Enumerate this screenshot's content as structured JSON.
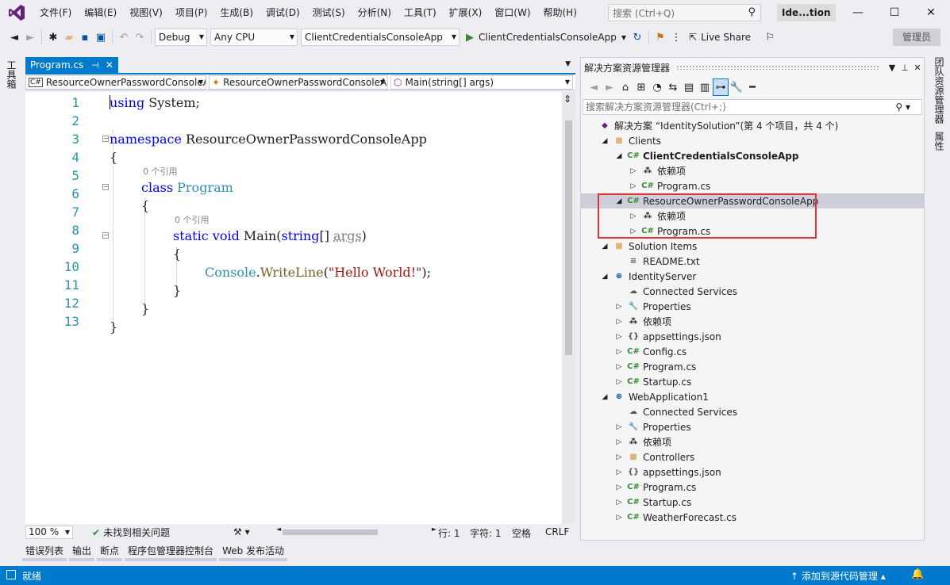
{
  "menu": {
    "items": [
      "文件(F)",
      "编辑(E)",
      "视图(V)",
      "项目(P)",
      "生成(B)",
      "调试(D)",
      "测试(S)",
      "分析(N)",
      "工具(T)",
      "扩展(X)",
      "窗口(W)",
      "帮助(H)"
    ],
    "search_placeholder": "搜索 (Ctrl+Q)",
    "title_badge": "Ide...tion"
  },
  "toolbar": {
    "config": "Debug",
    "platform": "Any CPU",
    "startup_project": "ClientCredentialsConsoleApp",
    "run_target": "ClientCredentialsConsoleApp",
    "live_share": "Live Share",
    "admin": "管理员"
  },
  "left_strip": {
    "toolbox": "工具箱"
  },
  "right_strip": {
    "team_explorer": "团队资源管理器",
    "properties": "属性"
  },
  "editor": {
    "tab_label": "Program.cs",
    "nav": {
      "project": "ResourceOwnerPasswordConsoleApp",
      "class": "ResourceOwnerPasswordConsoleApp.Program",
      "member": "Main(string[] args)"
    },
    "line_numbers": [
      "1",
      "2",
      "3",
      "4",
      "5",
      "6",
      "7",
      "8",
      "9",
      "10",
      "11",
      "12",
      "13"
    ],
    "code": {
      "l1_kw": "using",
      "l1_rest": " System;",
      "l3_kw": "namespace",
      "l3_rest": " ResourceOwnerPasswordConsoleApp",
      "l4": "{",
      "hint1": "0 个引用",
      "l5_kw": "class",
      "l5_type": "Program",
      "l6": "{",
      "hint2": "0 个引用",
      "l7_kw1": "static",
      "l7_kw2": "void",
      "l7_name": "Main(",
      "l7_kw3": "string",
      "l7_arr": "[] ",
      "l7_param": "args",
      "l7_close": ")",
      "l8": "{",
      "l9_type": "Console",
      "l9_dot": ".",
      "l9_method": "WriteLine",
      "l9_open": "(",
      "l9_str": "\"Hello World!\"",
      "l9_close": ");",
      "l10": "}",
      "l11": "}",
      "l12": "}"
    },
    "status": {
      "zoom": "100 %",
      "issues": "未找到相关问题",
      "line": "行: 1",
      "char": "字符: 1",
      "mode": "空格",
      "eol": "CRLF"
    }
  },
  "solution_explorer": {
    "title": "解决方案资源管理器",
    "search_placeholder": "搜索解决方案资源管理器(Ctrl+;)",
    "nodes": [
      {
        "label": "解决方案 “IdentitySolution”(第 4 个项目，共 4 个)",
        "icon": "solution-icon",
        "glyph": "◆"
      },
      {
        "label": "Clients",
        "icon": "folder-icon",
        "glyph": "■"
      },
      {
        "label": "ClientCredentialsConsoleApp",
        "icon": "csharp-project-icon",
        "glyph": "C#"
      },
      {
        "label": "依赖项",
        "icon": "dependencies-icon",
        "glyph": "⁂"
      },
      {
        "label": "Program.cs",
        "icon": "csharp-file-icon",
        "glyph": "C#"
      },
      {
        "label": "ResourceOwnerPasswordConsoleApp",
        "icon": "csharp-project-icon",
        "glyph": "C#"
      },
      {
        "label": "依赖项",
        "icon": "dependencies-icon",
        "glyph": "⁂"
      },
      {
        "label": "Program.cs",
        "icon": "csharp-file-icon",
        "glyph": "C#"
      },
      {
        "label": "Solution Items",
        "icon": "folder-icon",
        "glyph": "■"
      },
      {
        "label": "README.txt",
        "icon": "text-file-icon",
        "glyph": "≡"
      },
      {
        "label": "IdentityServer",
        "icon": "web-project-icon",
        "glyph": "⊕"
      },
      {
        "label": "Connected Services",
        "icon": "cloud-icon",
        "glyph": "☁"
      },
      {
        "label": "Properties",
        "icon": "wrench-icon",
        "glyph": "🔧"
      },
      {
        "label": "依赖项",
        "icon": "dependencies-icon",
        "glyph": "⁂"
      },
      {
        "label": "appsettings.json",
        "icon": "json-file-icon",
        "glyph": "{}"
      },
      {
        "label": "Config.cs",
        "icon": "csharp-file-icon",
        "glyph": "C#"
      },
      {
        "label": "Program.cs",
        "icon": "csharp-file-icon",
        "glyph": "C#"
      },
      {
        "label": "Startup.cs",
        "icon": "csharp-file-icon",
        "glyph": "C#"
      },
      {
        "label": "WebApplication1",
        "icon": "web-project-icon",
        "glyph": "⊕"
      },
      {
        "label": "Connected Services",
        "icon": "cloud-icon",
        "glyph": "☁"
      },
      {
        "label": "Properties",
        "icon": "wrench-icon",
        "glyph": "🔧"
      },
      {
        "label": "依赖项",
        "icon": "dependencies-icon",
        "glyph": "⁂"
      },
      {
        "label": "Controllers",
        "icon": "folder-icon",
        "glyph": "■"
      },
      {
        "label": "appsettings.json",
        "icon": "json-file-icon",
        "glyph": "{}"
      },
      {
        "label": "Program.cs",
        "icon": "csharp-file-icon",
        "glyph": "C#"
      },
      {
        "label": "Startup.cs",
        "icon": "csharp-file-icon",
        "glyph": "C#"
      },
      {
        "label": "WeatherForecast.cs",
        "icon": "csharp-file-icon",
        "glyph": "C#"
      }
    ]
  },
  "bottom_tabs": [
    "错误列表",
    "输出",
    "断点",
    "程序包管理器控制台",
    "Web 发布活动"
  ],
  "statusbar": {
    "ready": "就绪",
    "source_control": "添加到源代码管理"
  },
  "colors": {
    "accent": "#007acc",
    "keyword": "#0000ff",
    "type": "#2b91af",
    "string": "#a31515",
    "highlight_box": "#e53333"
  }
}
